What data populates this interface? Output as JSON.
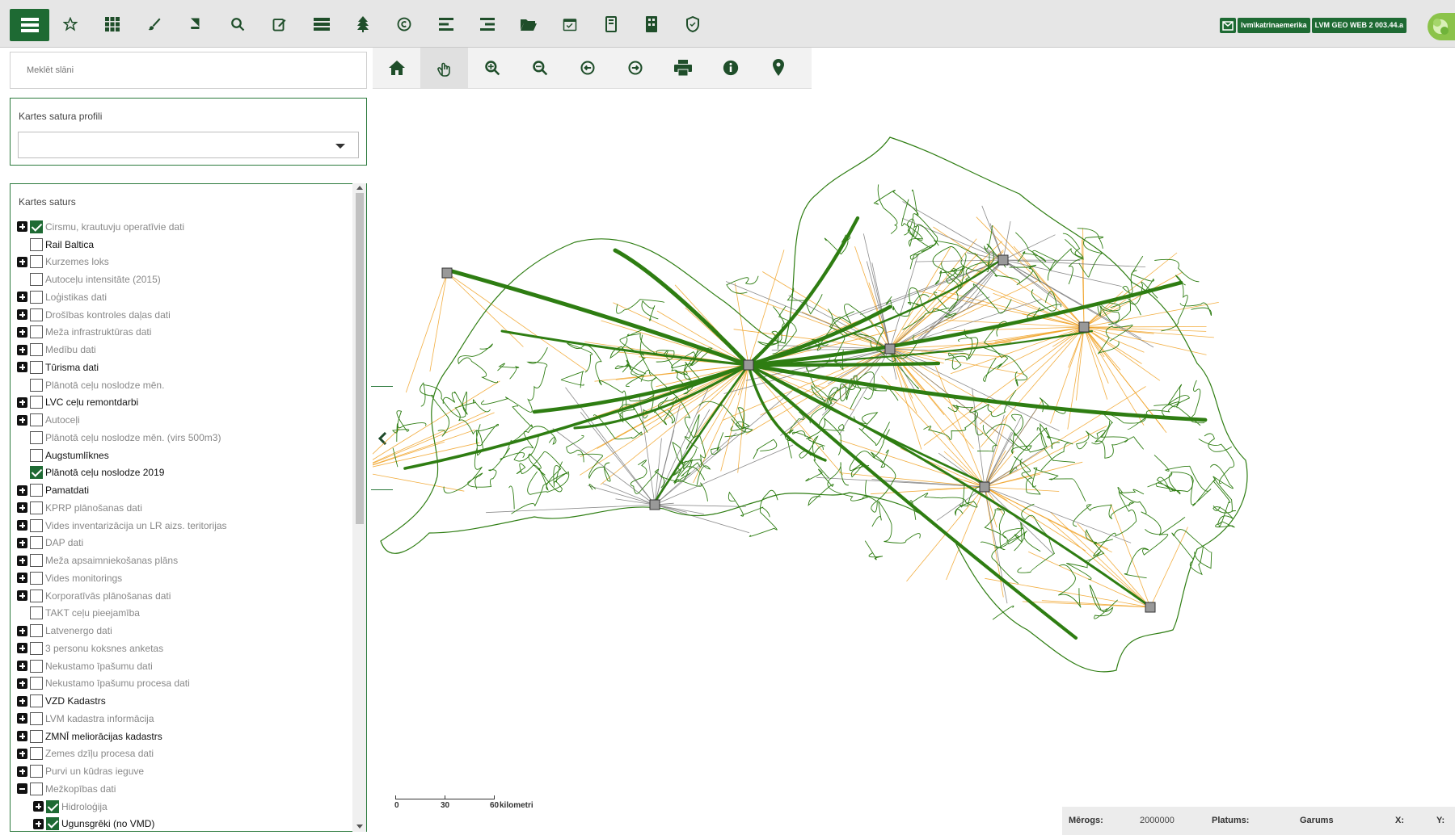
{
  "toolbar": {
    "icons": [
      "layers-list-icon",
      "star-icon",
      "grid-icon",
      "brush-icon",
      "book-icon",
      "search-icon",
      "edit-icon",
      "list-box-icon",
      "tree-icon",
      "copyright-icon",
      "align-left-icon",
      "align-right-icon",
      "folder-open-icon",
      "calendar-check-icon",
      "tablet-icon",
      "building-icon",
      "shield-icon"
    ],
    "user_badge": "lvm\\katrinaemerika",
    "version_badge": "LVM GEO WEB 2 003.44.a"
  },
  "search": {
    "placeholder": "Meklēt slāni"
  },
  "profiles": {
    "label": "Kartes satura profili",
    "selected": ""
  },
  "layers": {
    "title": "Kartes saturs",
    "items": [
      {
        "label": "Cirsmu, krautuvju operatīvie dati",
        "expand": true,
        "checked": true,
        "dark": false,
        "indent": 0
      },
      {
        "label": "Rail Baltica",
        "expand": false,
        "checked": false,
        "dark": true,
        "indent": 0
      },
      {
        "label": "Kurzemes loks",
        "expand": true,
        "checked": false,
        "dark": false,
        "indent": 0
      },
      {
        "label": "Autoceļu intensitāte (2015)",
        "expand": false,
        "checked": false,
        "dark": false,
        "indent": 0
      },
      {
        "label": "Loģistikas dati",
        "expand": true,
        "checked": false,
        "dark": false,
        "indent": 0
      },
      {
        "label": "Drošības kontroles daļas dati",
        "expand": true,
        "checked": false,
        "dark": false,
        "indent": 0
      },
      {
        "label": "Meža infrastruktūras dati",
        "expand": true,
        "checked": false,
        "dark": false,
        "indent": 0
      },
      {
        "label": "Medību dati",
        "expand": true,
        "checked": false,
        "dark": false,
        "indent": 0
      },
      {
        "label": "Tūrisma dati",
        "expand": true,
        "checked": false,
        "dark": true,
        "indent": 0
      },
      {
        "label": "Plānotā ceļu noslodze mēn.",
        "expand": false,
        "checked": false,
        "dark": false,
        "indent": 0
      },
      {
        "label": "LVC ceļu remontdarbi",
        "expand": true,
        "checked": false,
        "dark": true,
        "indent": 0
      },
      {
        "label": "Autoceļi",
        "expand": true,
        "checked": false,
        "dark": false,
        "indent": 0
      },
      {
        "label": "Plānotā ceļu noslodze mēn. (virs 500m3)",
        "expand": false,
        "checked": false,
        "dark": false,
        "indent": 0
      },
      {
        "label": "Augstumlīknes",
        "expand": false,
        "checked": false,
        "dark": true,
        "indent": 0
      },
      {
        "label": "Plānotā ceļu noslodze 2019",
        "expand": false,
        "checked": true,
        "dark": true,
        "indent": 0
      },
      {
        "label": "Pamatdati",
        "expand": true,
        "checked": false,
        "dark": true,
        "indent": 0
      },
      {
        "label": "KPRP plānošanas dati",
        "expand": true,
        "checked": false,
        "dark": false,
        "indent": 0
      },
      {
        "label": "Vides inventarizācija un LR aizs. teritorijas",
        "expand": true,
        "checked": false,
        "dark": false,
        "indent": 0
      },
      {
        "label": "DAP dati",
        "expand": true,
        "checked": false,
        "dark": false,
        "indent": 0
      },
      {
        "label": "Meža apsaimniekošanas plāns",
        "expand": true,
        "checked": false,
        "dark": false,
        "indent": 0
      },
      {
        "label": "Vides monitorings",
        "expand": true,
        "checked": false,
        "dark": false,
        "indent": 0
      },
      {
        "label": "Korporatīvās plānošanas dati",
        "expand": true,
        "checked": false,
        "dark": false,
        "indent": 0
      },
      {
        "label": "TAKT ceļu pieejamība",
        "expand": false,
        "checked": false,
        "dark": false,
        "indent": 0
      },
      {
        "label": "Latvenergo dati",
        "expand": true,
        "checked": false,
        "dark": false,
        "indent": 0
      },
      {
        "label": "3 personu koksnes anketas",
        "expand": true,
        "checked": false,
        "dark": false,
        "indent": 0
      },
      {
        "label": "Nekustamo īpašumu dati",
        "expand": true,
        "checked": false,
        "dark": false,
        "indent": 0
      },
      {
        "label": "Nekustamo īpašumu procesa dati",
        "expand": true,
        "checked": false,
        "dark": false,
        "indent": 0
      },
      {
        "label": "VZD Kadastrs",
        "expand": true,
        "checked": false,
        "dark": true,
        "indent": 0
      },
      {
        "label": "LVM kadastra informācija",
        "expand": true,
        "checked": false,
        "dark": false,
        "indent": 0
      },
      {
        "label": "ZMNĪ meliorācijas kadastrs",
        "expand": true,
        "checked": false,
        "dark": true,
        "indent": 0
      },
      {
        "label": "Zemes dzīļu procesa dati",
        "expand": true,
        "checked": false,
        "dark": false,
        "indent": 0
      },
      {
        "label": "Purvi un kūdras ieguve",
        "expand": true,
        "checked": false,
        "dark": false,
        "indent": 0
      },
      {
        "label": "Mežkopības dati",
        "expand": true,
        "checked": false,
        "dark": false,
        "indent": 0,
        "open": true
      },
      {
        "label": "Hidroloģija",
        "expand": true,
        "checked": true,
        "dark": false,
        "indent": 1
      },
      {
        "label": "Ugunsgrēki (no VMD)",
        "expand": true,
        "checked": true,
        "dark": true,
        "indent": 1
      }
    ]
  },
  "maptools": [
    "home-icon",
    "pan-hand-icon",
    "zoom-in-icon",
    "zoom-out-icon",
    "back-icon",
    "forward-icon",
    "print-icon",
    "info-icon",
    "location-pin-icon"
  ],
  "scale": {
    "t0": "0",
    "t1": "30",
    "t2": "60",
    "unit": "kilometri"
  },
  "status": {
    "merogs_label": "Mērogs:",
    "merogs_value": "2000000",
    "platums_label": "Platums:",
    "garums_label": "Garums",
    "x_label": "X:",
    "y_label": "Y:"
  },
  "colors": {
    "brand": "#1e6a33",
    "roads": "#2e7d12",
    "orange": "#f0a020",
    "grey_lines": "#777777"
  }
}
